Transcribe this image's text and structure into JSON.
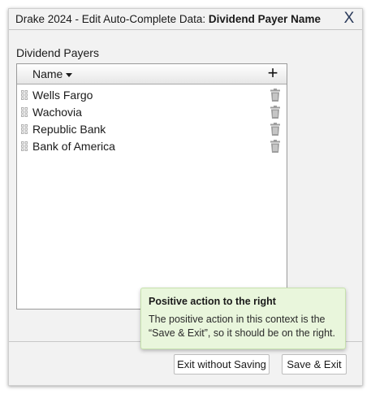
{
  "window": {
    "title_prefix": "Drake 2024 - ",
    "title_light": "Edit Auto-Complete Data: ",
    "title_bold": "Dividend Payer Name",
    "close_glyph": "X"
  },
  "section_label": "Dividend Payers",
  "list": {
    "column_header": "Name",
    "add_glyph": "+",
    "items": [
      {
        "label": "Wells Fargo"
      },
      {
        "label": "Wachovia"
      },
      {
        "label": "Republic Bank"
      },
      {
        "label": "Bank of America"
      }
    ]
  },
  "buttons": {
    "exit_label": "Exit without Saving",
    "save_label": "Save & Exit"
  },
  "tooltip": {
    "title": "Positive action to the right",
    "body": "The positive action in this context is the “Save & Exit”, so it should be on the right."
  },
  "colors": {
    "tooltip_bg": "#e9f6dc",
    "icon_gray": "#9e9e9e"
  }
}
